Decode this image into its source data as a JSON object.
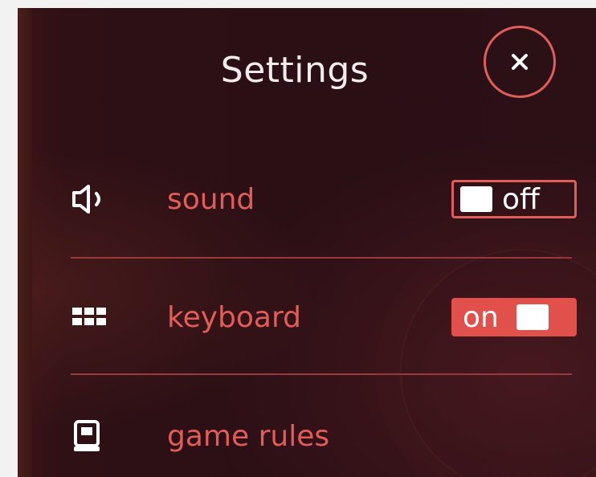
{
  "header": {
    "title": "Settings",
    "close_icon": "close-icon"
  },
  "settings": {
    "sound": {
      "label": "sound",
      "icon": "speaker-icon",
      "toggle_text": "off",
      "state": "off"
    },
    "keyboard": {
      "label": "keyboard",
      "icon": "keyboard-grid-icon",
      "toggle_text": "on",
      "state": "on"
    },
    "game_rules": {
      "label": "game rules",
      "icon": "rulebook-icon"
    }
  },
  "colors": {
    "accent": "#e05d5a",
    "background": "#2a0f15",
    "title_text": "#f4ecec",
    "label_text": "#e25d57"
  }
}
